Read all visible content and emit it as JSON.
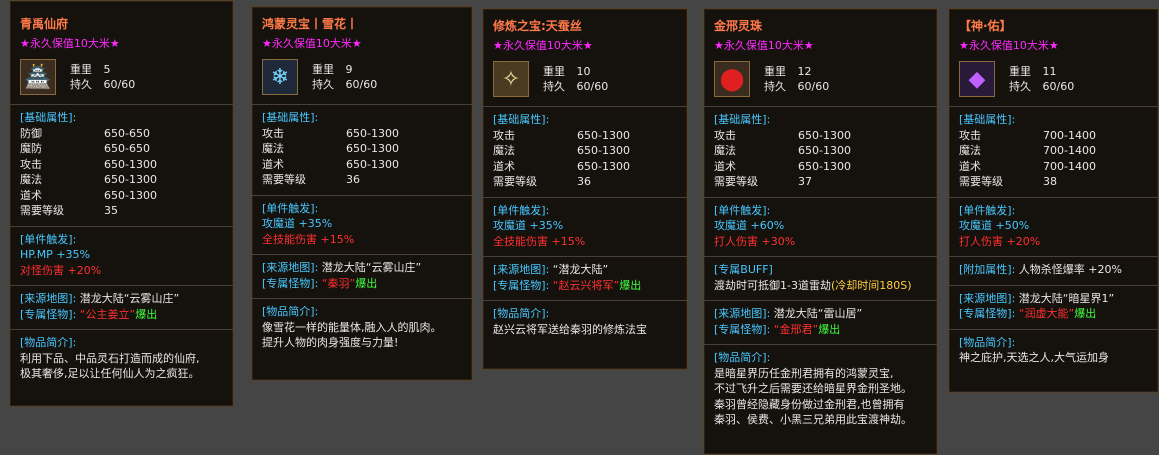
{
  "cards": [
    {
      "title": "青禹仙府",
      "subtitle": "★永久保值10大米★",
      "icon": "treasure-chest-icon",
      "weight_label": "重里",
      "weight": "5",
      "durability_label": "持久",
      "durability": "60/60",
      "base_header": "[基础属性]:",
      "base": [
        {
          "k": "防御",
          "v": "650-650"
        },
        {
          "k": "魔防",
          "v": "650-650"
        },
        {
          "k": "攻击",
          "v": "650-1300"
        },
        {
          "k": "魔法",
          "v": "650-1300"
        },
        {
          "k": "道术",
          "v": "650-1300"
        },
        {
          "k": "需要等级",
          "v": "35"
        }
      ],
      "trigger_header": "[单件触发]:",
      "trigger": [
        {
          "k": "HP.MP",
          "v": "+35%"
        },
        {
          "k": "对怪伤害",
          "v": "+20%"
        }
      ],
      "source_label": "[来源地图]:",
      "source_value": "潜龙大陆“云雾山庄”",
      "monster_label": "[专属怪物]:",
      "monster_value": "“公主姜立”",
      "drop": "爆出",
      "intro_header": "[物品简介]:",
      "intro": [
        "利用下品、中品灵石打造而成的仙府,",
        "极其奢侈,足以让任何仙人为之疯狂。"
      ]
    },
    {
      "title": "鸿蒙灵宝丨雪花丨",
      "subtitle": "★永久保值10大米★",
      "icon": "snowflake-icon",
      "weight_label": "重里",
      "weight": "9",
      "durability_label": "持久",
      "durability": "60/60",
      "base_header": "[基础属性]:",
      "base": [
        {
          "k": "攻击",
          "v": "650-1300"
        },
        {
          "k": "魔法",
          "v": "650-1300"
        },
        {
          "k": "道术",
          "v": "650-1300"
        },
        {
          "k": "需要等级",
          "v": "36"
        }
      ],
      "trigger_header": "[单件触发]:",
      "trigger": [
        {
          "k": "攻魔道",
          "v": "+35%"
        },
        {
          "k": "全技能伤害",
          "v": "+15%"
        }
      ],
      "source_label": "[来源地图]:",
      "source_value": "潜龙大陆“云雾山庄”",
      "monster_label": "[专属怪物]:",
      "monster_value": "“秦羽”",
      "drop": "爆出",
      "intro_header": "[物品简介]:",
      "intro": [
        "像雪花一样的能量体,融入人的肌肉。",
        "提升人物的肉身强度与力量!"
      ]
    },
    {
      "title": "修炼之宝:天蚕丝",
      "subtitle": "★永久保值10大米★",
      "icon": "silk-thread-icon",
      "weight_label": "重里",
      "weight": "10",
      "durability_label": "持久",
      "durability": "60/60",
      "base_header": "[基础属性]:",
      "base": [
        {
          "k": "攻击",
          "v": "650-1300"
        },
        {
          "k": "魔法",
          "v": "650-1300"
        },
        {
          "k": "道术",
          "v": "650-1300"
        },
        {
          "k": "需要等级",
          "v": "36"
        }
      ],
      "trigger_header": "[单件触发]:",
      "trigger": [
        {
          "k": "攻魔道",
          "v": "+35%"
        },
        {
          "k": "全技能伤害",
          "v": "+15%"
        }
      ],
      "source_label": "[来源地图]:",
      "source_value": "“潜龙大陆”",
      "monster_label": "[专属怪物]:",
      "monster_value": "“赵云兴将军”",
      "drop": "爆出",
      "intro_header": "[物品简介]:",
      "intro": [
        "赵兴云将军送给秦羽的修炼法宝"
      ]
    },
    {
      "title": "金邢灵珠",
      "subtitle": "★永久保值10大米★",
      "icon": "red-orb-icon",
      "weight_label": "重里",
      "weight": "12",
      "durability_label": "持久",
      "durability": "60/60",
      "base_header": "[基础属性]:",
      "base": [
        {
          "k": "攻击",
          "v": "650-1300"
        },
        {
          "k": "魔法",
          "v": "650-1300"
        },
        {
          "k": "道术",
          "v": "650-1300"
        },
        {
          "k": "需要等级",
          "v": "37"
        }
      ],
      "trigger_header": "[单件触发]:",
      "trigger": [
        {
          "k": "攻魔道",
          "v": "+60%"
        },
        {
          "k": "打人伤害",
          "v": "+30%"
        }
      ],
      "buff_header": "[专属BUFF]",
      "buff_text": "渡劫时可抵御1-3道雷劫",
      "buff_cd": "(冷却时间180S)",
      "source_label": "[来源地图]:",
      "source_value": "潜龙大陆“雷山居”",
      "monster_label": "[专属怪物]:",
      "monster_value": "“金邢君”",
      "drop": "爆出",
      "intro_header": "[物品简介]:",
      "intro": [
        "是暗星界历任金刑君拥有的鸿蒙灵宝,",
        "不过飞升之后需要还给暗星界金刑圣地。",
        "秦羽曾经隐藏身份做过金刑君,也曾拥有",
        "秦羽、侯费、小黑三兄弟用此宝渡神劫。"
      ]
    },
    {
      "title": "【神·佑】",
      "subtitle": "★永久保值10大米★",
      "icon": "purple-book-icon",
      "weight_label": "重里",
      "weight": "11",
      "durability_label": "持久",
      "durability": "60/60",
      "base_header": "[基础属性]:",
      "base": [
        {
          "k": "攻击",
          "v": "700-1400"
        },
        {
          "k": "魔法",
          "v": "700-1400"
        },
        {
          "k": "道术",
          "v": "700-1400"
        },
        {
          "k": "需要等级",
          "v": "38"
        }
      ],
      "trigger_header": "[单件触发]:",
      "trigger": [
        {
          "k": "攻魔道",
          "v": "+50%"
        },
        {
          "k": "打人伤害",
          "v": "+20%"
        }
      ],
      "extra_label": "[附加属性]:",
      "extra_value": "人物杀怪爆率 +20%",
      "source_label": "[来源地图]:",
      "source_value": "潜龙大陆“暗星界1”",
      "monster_label": "[专属怪物]:",
      "monster_value": "“润虚大能”",
      "drop": "爆出",
      "intro_header": "[物品简介]:",
      "intro": [
        "神之庇护,天选之人,大气运加身"
      ]
    }
  ]
}
